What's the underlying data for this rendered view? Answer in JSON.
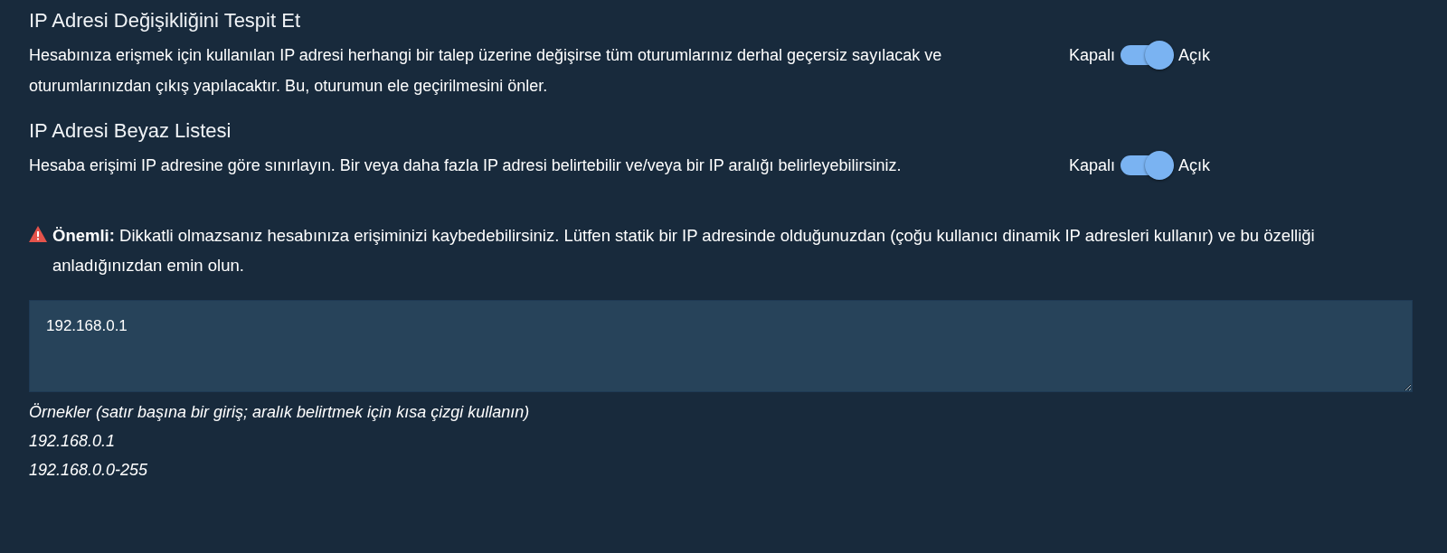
{
  "settings": [
    {
      "title": "IP Adresi Değişikliğini Tespit Et",
      "description": "Hesabınıza erişmek için kullanılan IP adresi herhangi bir talep üzerine değişirse tüm oturumlarınız derhal geçersiz sayılacak ve oturumlarınızdan çıkış yapılacaktır. Bu, oturumun ele geçirilmesini önler.",
      "off_label": "Kapalı",
      "on_label": "Açık",
      "on": true
    },
    {
      "title": "IP Adresi Beyaz Listesi",
      "description": "Hesaba erişimi IP adresine göre sınırlayın. Bir veya daha fazla IP adresi belirtebilir ve/veya bir IP aralığı belirleyebilirsiniz.",
      "off_label": "Kapalı",
      "on_label": "Açık",
      "on": true
    }
  ],
  "warning": "**Önemli:** Dikkatli olmazsanız hesabınıza erişiminizi kaybedebilirsiniz. Lütfen statik bir IP adresinde olduğunuzdan (çoğu kullanıcı dinamik IP adresleri kullanır) ve bu özelliği anladığınızdan emin olun.",
  "whitelist_field": {
    "value": "192.168.0.1"
  },
  "examples": [
    "Örnekler (satır başına bir giriş; aralık belirtmek için kısa çizgi kullanın)",
    "192.168.0.1",
    "192.168.0.0-255"
  ]
}
